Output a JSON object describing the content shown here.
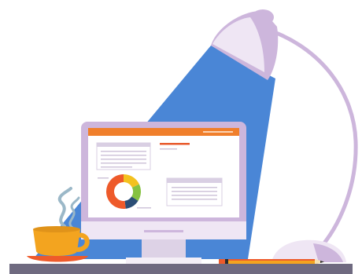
{
  "scene": {
    "description_label": "",
    "elements": {
      "desk_lamp": "lamp-icon",
      "monitor": "monitor-icon",
      "coffee_cup": "cup-icon",
      "pencil": "pencil-icon",
      "donut_chart": "donut-chart-icon"
    }
  },
  "colors": {
    "light_beam": "#4a86d6",
    "lamp_body": "#cdb6dc",
    "lamp_light": "#efe6f4",
    "monitor_frame": "#cdb6dc",
    "screen_bg": "#ffffff",
    "screen_header": "#f07f2c",
    "desk": "#6f6a80",
    "cup": "#f3a41f",
    "saucer": "#ee5a2a",
    "steam": "#9bb8c8",
    "pencil_body": "#f3a41f",
    "pencil_stripe": "#ee5a2a",
    "donut_segments": [
      "#f3c11f",
      "#86c241",
      "#2b4e76",
      "#ee5a2a"
    ],
    "panel_lines": "#cfc4da",
    "accent_line": "#e85a2c"
  },
  "donut": {
    "segments": [
      0.18,
      0.16,
      0.14,
      0.52
    ]
  }
}
